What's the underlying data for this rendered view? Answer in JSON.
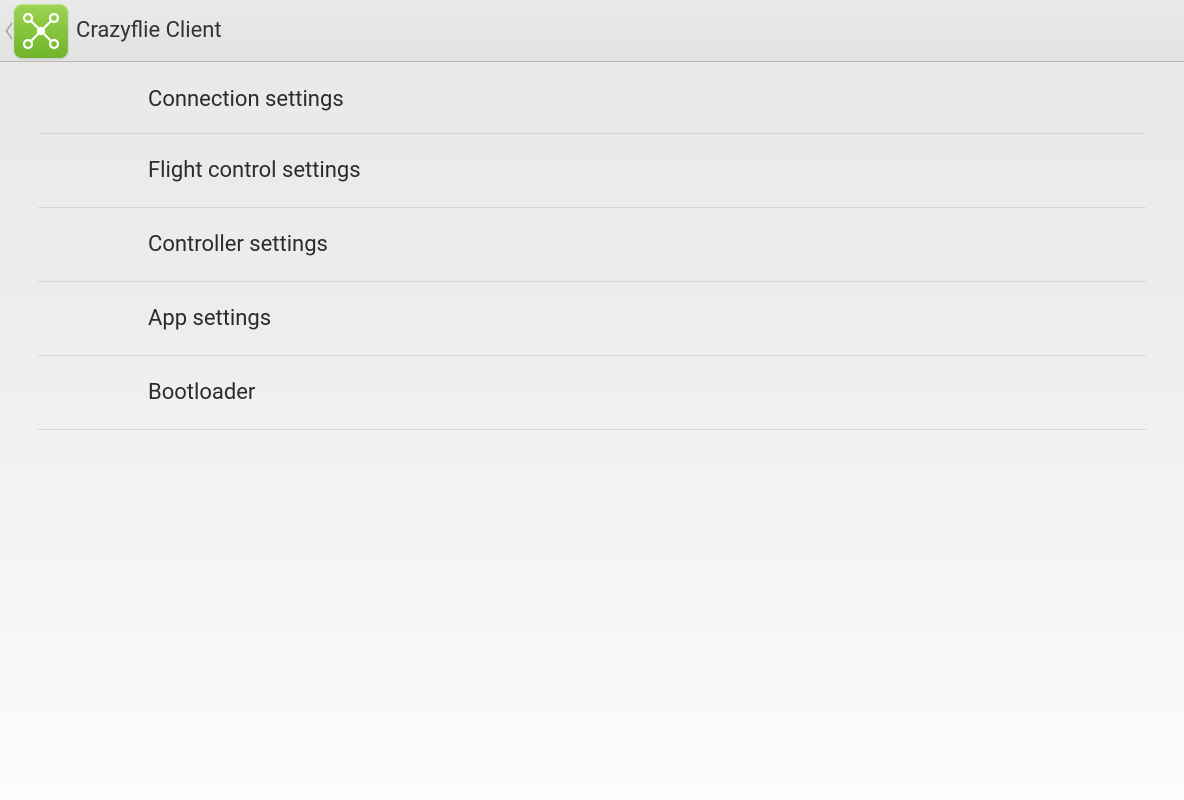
{
  "header": {
    "title": "Crazyflie Client"
  },
  "settings": {
    "items": [
      {
        "label": "Connection settings"
      },
      {
        "label": "Flight control settings"
      },
      {
        "label": "Controller settings"
      },
      {
        "label": "App settings"
      },
      {
        "label": "Bootloader"
      }
    ]
  }
}
